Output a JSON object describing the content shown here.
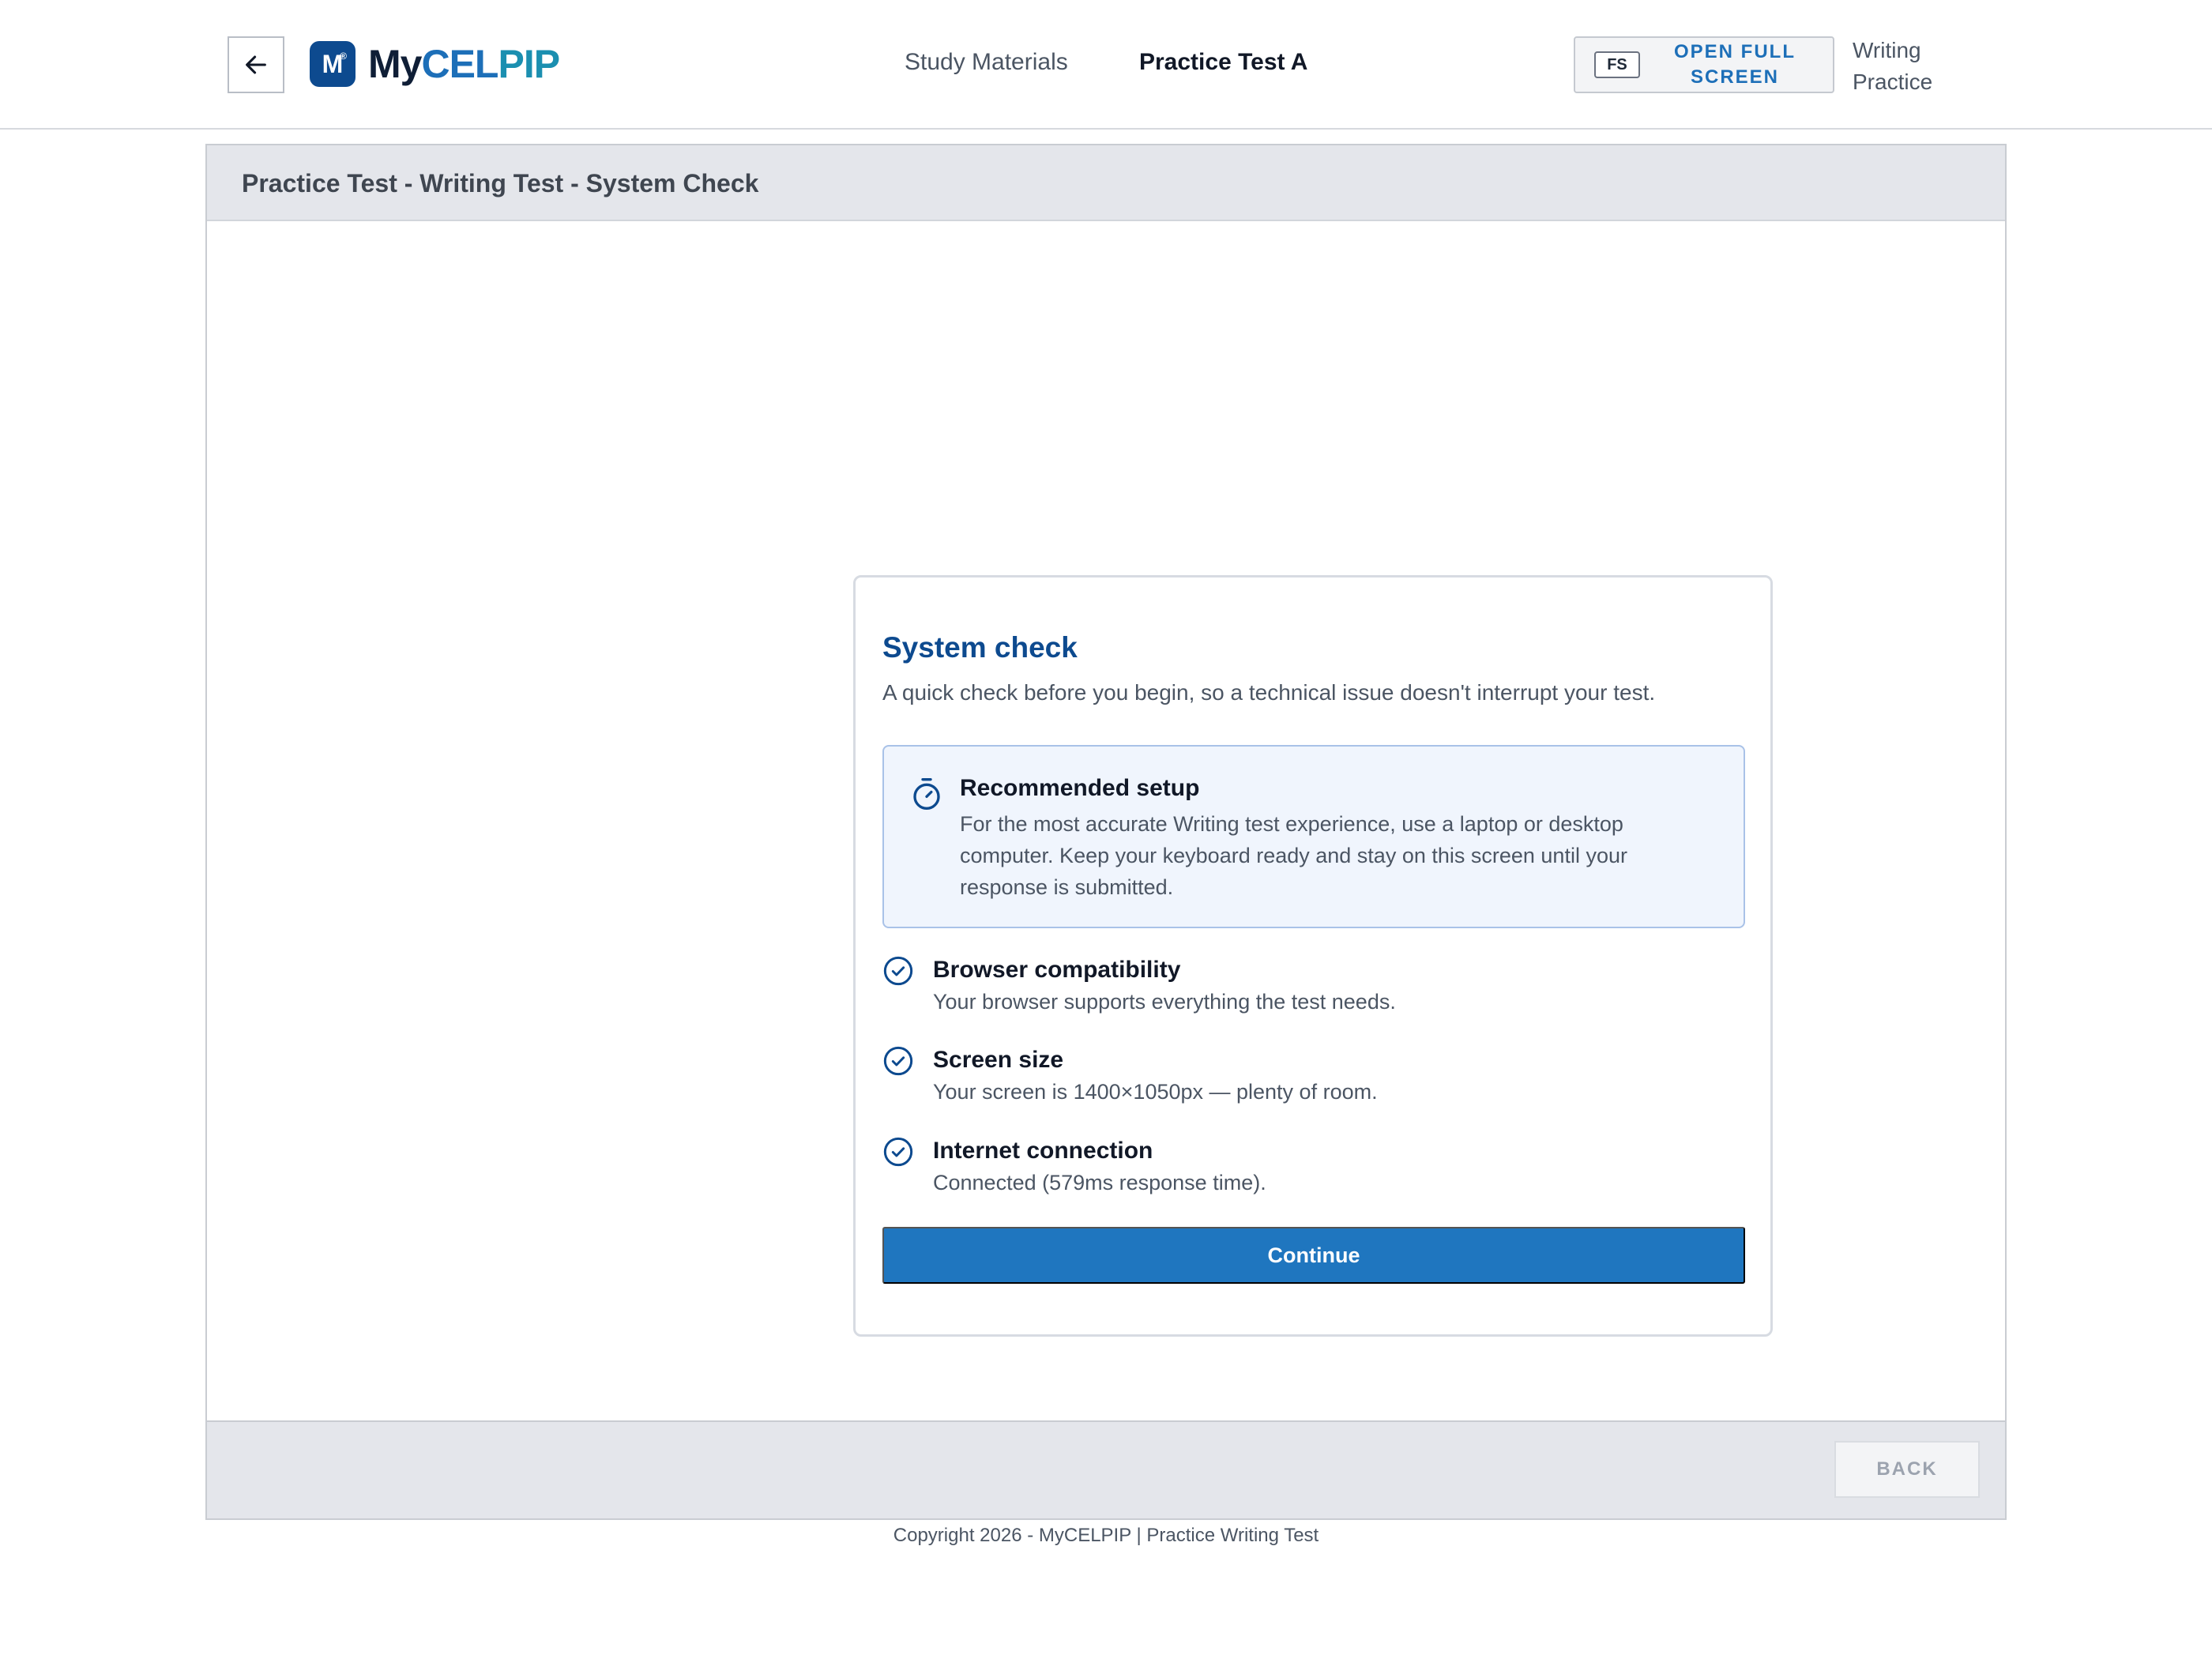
{
  "nav": {
    "back_icon": "arrow-left-icon",
    "logo": {
      "mark": "M",
      "mark_sup": "®",
      "my": "My",
      "cel": "CEL",
      "pip": "PIP"
    },
    "links": [
      {
        "label": "Study Materials",
        "active": false
      },
      {
        "label": "Practice Test A",
        "active": true
      }
    ],
    "fullscreen": {
      "key": "FS",
      "label": "OPEN FULL SCREEN"
    },
    "mode_label": "Writing Practice"
  },
  "panel": {
    "title": "Practice Test - Writing Test - System Check",
    "footer_back_label": "BACK"
  },
  "card": {
    "title": "System check",
    "subtitle": "A quick check before you begin, so a technical issue doesn't interrupt your test.",
    "setup": {
      "icon": "stopwatch-icon",
      "title": "Recommended setup",
      "body": "For the most accurate Writing test experience, use a laptop or desktop computer. Keep your keyboard ready and stay on this screen until your response is submitted."
    },
    "checks": [
      {
        "icon": "check-circle-icon",
        "title": "Browser compatibility",
        "desc": "Your browser supports everything the test needs."
      },
      {
        "icon": "check-circle-icon",
        "title": "Screen size",
        "desc": "Your screen is 1400×1050px — plenty of room."
      },
      {
        "icon": "check-circle-icon",
        "title": "Internet connection",
        "desc": "Connected (579ms response time)."
      }
    ],
    "continue_label": "Continue"
  },
  "footer": {
    "copyright": "Copyright 2026 - MyCELPIP | Practice Writing Test"
  },
  "colors": {
    "brand_navy": "#0d4a8f",
    "accent_blue": "#1f76bf",
    "header_gray": "#e4e6eb"
  }
}
